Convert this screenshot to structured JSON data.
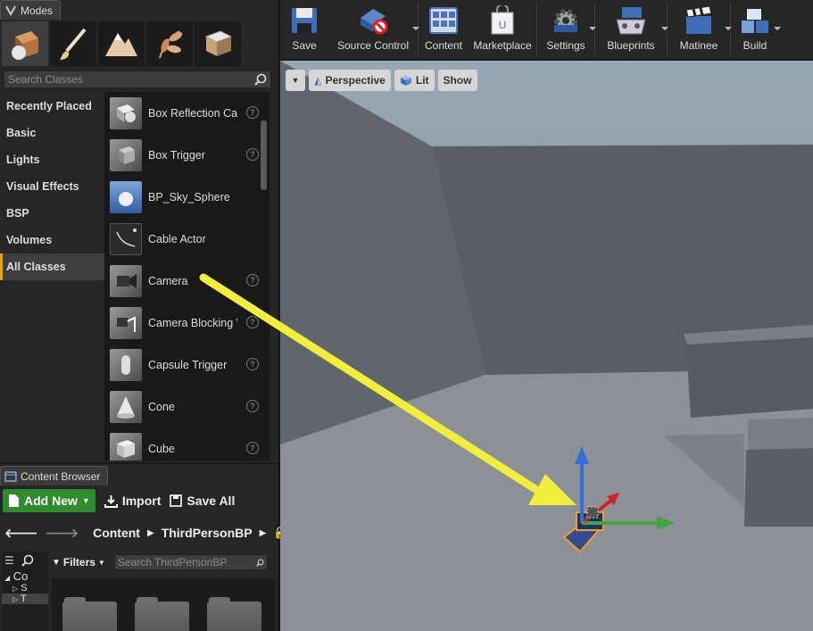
{
  "modes_panel": {
    "tab_title": "Modes",
    "search_placeholder": "Search Classes",
    "categories": [
      "Recently Placed",
      "Basic",
      "Lights",
      "Visual Effects",
      "BSP",
      "Volumes",
      "All Classes"
    ],
    "active_category": "All Classes",
    "classes": [
      "Box Reflection Capture",
      "Box Trigger",
      "BP_Sky_Sphere",
      "Cable Actor",
      "Camera",
      "Camera Blocking Volume",
      "Capsule Trigger",
      "Cone",
      "Cube"
    ]
  },
  "content_browser": {
    "tab_title": "Content Browser",
    "add_new_label": "Add New",
    "import_label": "Import",
    "save_all_label": "Save All",
    "path": [
      "Content",
      "ThirdPersonBP"
    ],
    "filters_label": "Filters",
    "search_placeholder": "Search ThirdPersonBP",
    "source_items": [
      "Co",
      "S",
      "T"
    ]
  },
  "toolbar": {
    "buttons": [
      "Save",
      "Source Control",
      "Content",
      "Marketplace",
      "Settings",
      "Blueprints",
      "Matinee",
      "Build"
    ]
  },
  "viewport": {
    "perspective_label": "Perspective",
    "lit_label": "Lit",
    "show_label": "Show"
  },
  "colors": {
    "accent_orange": "#e8a218",
    "add_new_green": "#2e8b2e",
    "annotation_yellow": "#f2ef3c",
    "gizmo_blue": "#2f6fd6",
    "gizmo_green": "#3fa63f",
    "gizmo_red": "#c8281e"
  }
}
